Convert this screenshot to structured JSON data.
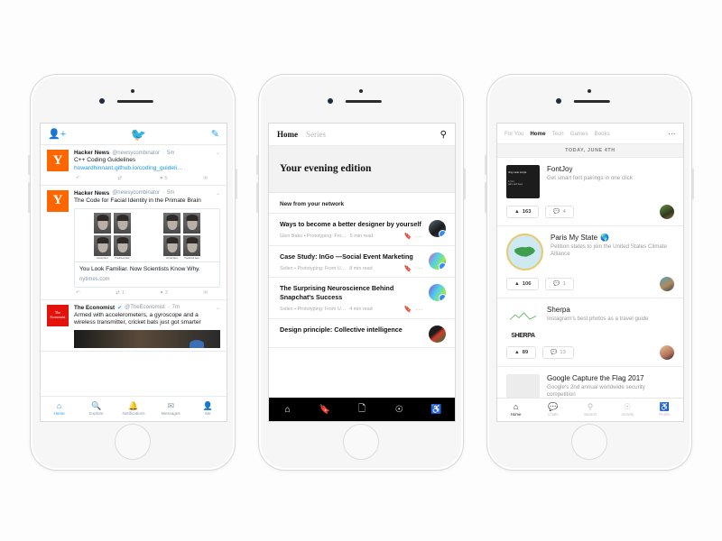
{
  "phone1": {
    "app": "Twitter",
    "topbar": {
      "left_icon": "add-person-icon",
      "logo": "twitter-bird-icon",
      "right_icon": "compose-icon"
    },
    "tweets": [
      {
        "avatar_letter": "Y",
        "name": "Hacker News",
        "handle": "@newsycombinator",
        "time": "5m",
        "verified": false,
        "text": "C++ Coding Guidelines",
        "link": "howardhinnant.github.io/coding_guideli…",
        "actions": {
          "reply": "",
          "retweet": "",
          "like": "5",
          "share": ""
        }
      },
      {
        "avatar_letter": "Y",
        "name": "Hacker News",
        "handle": "@newsycombinator",
        "time": "5m",
        "verified": false,
        "text": "The Code for Facial Identity in the Primate Brain",
        "card": {
          "labels": [
            "Actual face",
            "Predicted face",
            "Actual face",
            "Predicted face"
          ],
          "title": "You Look Familiar. Now Scientists Know Why.",
          "domain": "nytimes.com"
        },
        "actions": {
          "reply": "",
          "retweet": "1",
          "like": "3",
          "share": ""
        }
      },
      {
        "avatar_letter": "The Economist",
        "name": "The Economist",
        "handle": "@TheEconomist",
        "time": "7m",
        "verified": true,
        "text": "Armed with accelerometers, a gyroscope and a wireless transmitter, cricket bats just got smarter"
      }
    ],
    "tabbar": [
      {
        "icon": "home-icon",
        "label": "Home",
        "active": true
      },
      {
        "icon": "search-icon",
        "label": "Explore",
        "active": false
      },
      {
        "icon": "bell-icon",
        "label": "Notifications",
        "active": false
      },
      {
        "icon": "envelope-icon",
        "label": "Messages",
        "active": false
      },
      {
        "icon": "person-icon",
        "label": "Me",
        "active": false
      }
    ]
  },
  "phone2": {
    "app": "Medium",
    "tabs": [
      {
        "label": "Home",
        "active": true
      },
      {
        "label": "Series",
        "active": false
      }
    ],
    "search_icon": "search-icon",
    "hero_title": "Your evening edition",
    "section_title": "New from your network",
    "items": [
      {
        "title": "Ways to become a better designer by yourself",
        "byline": "Glen Baku • Prototyping: Fro…",
        "read_time": "5 min read",
        "bookmark_icon": "bookmark-icon",
        "more_icon": "ellipsis-icon"
      },
      {
        "title": "Case Study: InGo —Social Event Marketing",
        "byline": "Svilen • Prototyping: From U…",
        "read_time": "8 min read",
        "bookmark_icon": "bookmark-icon",
        "more_icon": "ellipsis-icon"
      },
      {
        "title": "The Surprising Neuroscience Behind Snapchat's Success",
        "byline": "Svilen • Prototyping: From U…",
        "read_time": "4 min read",
        "bookmark_icon": "bookmark-icon",
        "more_icon": "ellipsis-icon"
      },
      {
        "title": "Design principle: Collective intelligence",
        "byline": "",
        "read_time": "",
        "bookmark_icon": "bookmark-icon",
        "more_icon": "ellipsis-icon"
      }
    ],
    "tabbar": [
      {
        "icon": "home-icon"
      },
      {
        "icon": "bookmark-icon"
      },
      {
        "icon": "new-story-icon"
      },
      {
        "icon": "bell-icon"
      },
      {
        "icon": "person-icon"
      }
    ]
  },
  "phone3": {
    "app": "Product Hunt",
    "tabs": [
      {
        "label": "For You",
        "active": false
      },
      {
        "label": "Home",
        "active": true
      },
      {
        "label": "Tech",
        "active": false
      },
      {
        "label": "Games",
        "active": false
      },
      {
        "label": "Books",
        "active": false
      }
    ],
    "more_icon": "ellipsis-icon",
    "date_header": "TODAY, JUNE 4TH",
    "items": [
      {
        "name": "FontJoy",
        "emoji": "",
        "tagline": "Get smart font pairings in one click",
        "upvotes": "163",
        "comments": "4",
        "upvote_icon": "triangle-up-icon",
        "comment_icon": "comment-icon"
      },
      {
        "name": "Paris My State",
        "emoji": "🌎",
        "tagline": "Petition states to join the United States Climate Alliance",
        "upvotes": "106",
        "comments": "1",
        "upvote_icon": "triangle-up-icon",
        "comment_icon": "comment-icon"
      },
      {
        "name": "Sherpa",
        "emoji": "",
        "tagline": "Instagram's best photos as a travel guide",
        "upvotes": "89",
        "comments": "13",
        "upvote_icon": "triangle-up-icon",
        "comment_icon": "comment-icon"
      },
      {
        "name": "Google Capture the Flag 2017",
        "emoji": "",
        "tagline": "Google's 2nd annual worldwide security competition",
        "upvotes": "",
        "comments": "",
        "upvote_icon": "triangle-up-icon",
        "comment_icon": "comment-icon"
      }
    ],
    "sherpa_wordmark": "SHERPA",
    "tabbar": [
      {
        "icon": "home-icon",
        "label": "Home",
        "active": true
      },
      {
        "icon": "chat-icon",
        "label": "Chats",
        "active": false
      },
      {
        "icon": "search-icon",
        "label": "Search",
        "active": false
      },
      {
        "icon": "bell-icon",
        "label": "Activity",
        "active": false
      },
      {
        "icon": "person-icon",
        "label": "Profile",
        "active": false
      }
    ]
  }
}
